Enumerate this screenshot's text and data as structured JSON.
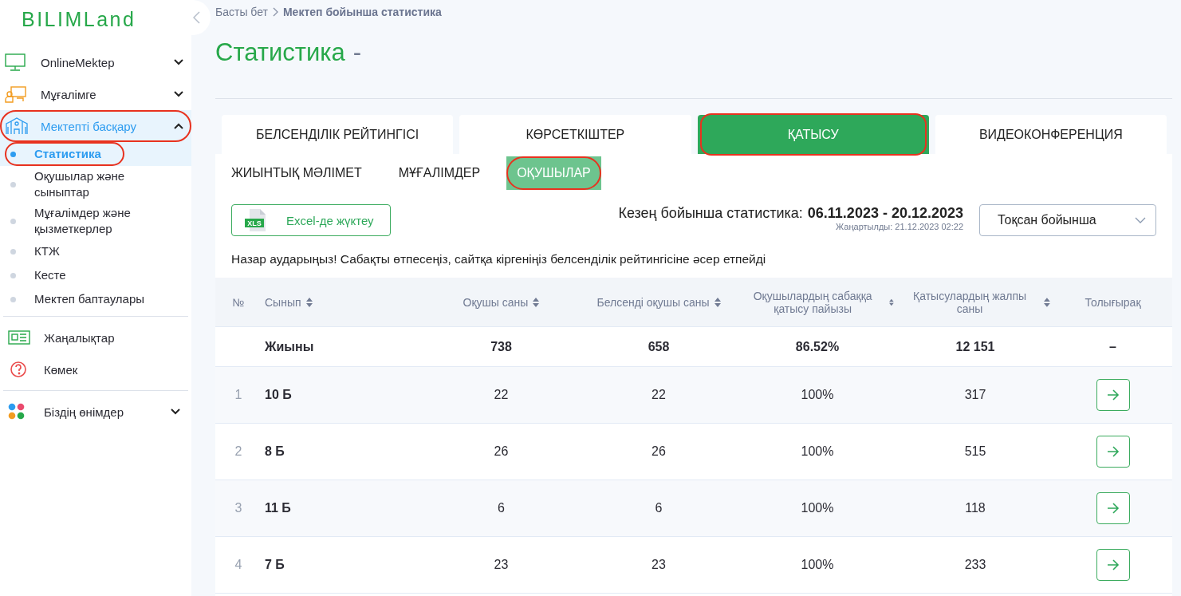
{
  "sidebar": {
    "logo": "BILIMLand",
    "sections": [
      {
        "items": [
          {
            "kind": "group",
            "label": "OnlineMektep",
            "expanded": false,
            "selected": false,
            "highlighted": false
          },
          {
            "kind": "group",
            "label": "Мұғалімге",
            "expanded": false,
            "selected": false,
            "highlighted": false
          },
          {
            "kind": "group",
            "label": "Мектепті басқару",
            "expanded": true,
            "selected": true,
            "highlighted": true,
            "children": [
              {
                "label": "Статистика",
                "selected": true,
                "highlighted": true
              },
              {
                "label": "Оқушылар және сыныптар",
                "selected": false,
                "highlighted": false
              },
              {
                "label": "Мұғалімдер және қызметкерлер",
                "selected": false,
                "highlighted": false
              },
              {
                "label": "КТЖ",
                "selected": false,
                "highlighted": false
              },
              {
                "label": "Кесте",
                "selected": false,
                "highlighted": false
              },
              {
                "label": "Мектеп баптаулары",
                "selected": false,
                "highlighted": false
              }
            ]
          }
        ]
      },
      {
        "items": [
          {
            "kind": "link",
            "label": "Жаңалықтар",
            "selected": false,
            "highlighted": false
          },
          {
            "kind": "link",
            "label": "Көмек",
            "selected": false,
            "highlighted": false
          }
        ]
      },
      {
        "items": [
          {
            "kind": "group",
            "label": "Біздің өнімдер",
            "expanded": false,
            "selected": false,
            "highlighted": false
          }
        ]
      }
    ]
  },
  "breadcrumb": [
    "Басты бет",
    "Мектеп бойынша статистика"
  ],
  "title": {
    "main": "Статистика",
    "suffix": "-"
  },
  "tabs": [
    {
      "label": "БЕЛСЕНДІЛІК РЕЙТИНГІСІ",
      "selected": false,
      "highlighted": false
    },
    {
      "label": "КӨРСЕТКІШТЕР",
      "selected": false,
      "highlighted": false
    },
    {
      "label": "ҚАТЫСУ",
      "selected": true,
      "highlighted": true
    },
    {
      "label": "ВИДЕОКОНФЕРЕНЦИЯ",
      "selected": false,
      "highlighted": false
    }
  ],
  "subtabs": [
    {
      "label": "ЖИЫНТЫҚ МӘЛІМЕТ",
      "selected": false,
      "highlighted": false
    },
    {
      "label": "МҰҒАЛІМДЕР",
      "selected": false,
      "highlighted": false
    },
    {
      "label": "ОҚУШЫЛАР",
      "selected": true,
      "highlighted": true
    }
  ],
  "excel_button": {
    "label": "Excel-де жүктеу",
    "icon_label": "XLS"
  },
  "period": {
    "label": "Кезең бойынша статистика:",
    "range": "06.11.2023 - 20.12.2023",
    "updated": "Жаңартылды: 21.12.2023 02:22"
  },
  "period_select": {
    "value": "Тоқсан бойынша"
  },
  "notice": "Назар аударыңыз! Сабақты өтпесеңіз, сайтқа кіргеніңіз белсенділік рейтингісіне әсер етпейді",
  "table": {
    "columns": [
      {
        "label": "№",
        "sortable": false
      },
      {
        "label": "Сынып",
        "sortable": true
      },
      {
        "label": "Оқушы саны",
        "sortable": true
      },
      {
        "label": "Белсенді оқушы саны",
        "sortable": true
      },
      {
        "label": "Оқушылардың сабаққа қатысу пайызы",
        "sortable": true
      },
      {
        "label": "Қатысулардың жалпы саны",
        "sortable": true
      },
      {
        "label": "Толығырақ",
        "sortable": false
      }
    ],
    "total": {
      "label": "Жиыны",
      "students": "738",
      "active": "658",
      "percent": "86.52%",
      "visits": "12 151",
      "details": "–"
    },
    "rows": [
      {
        "number": "1",
        "class": "10 Б",
        "students": "22",
        "active": "22",
        "percent": "100%",
        "visits": "317"
      },
      {
        "number": "2",
        "class": "8 Б",
        "students": "26",
        "active": "26",
        "percent": "100%",
        "visits": "515"
      },
      {
        "number": "3",
        "class": "11 Б",
        "students": "6",
        "active": "6",
        "percent": "100%",
        "visits": "118"
      },
      {
        "number": "4",
        "class": "7 Б",
        "students": "23",
        "active": "23",
        "percent": "100%",
        "visits": "233"
      }
    ]
  }
}
